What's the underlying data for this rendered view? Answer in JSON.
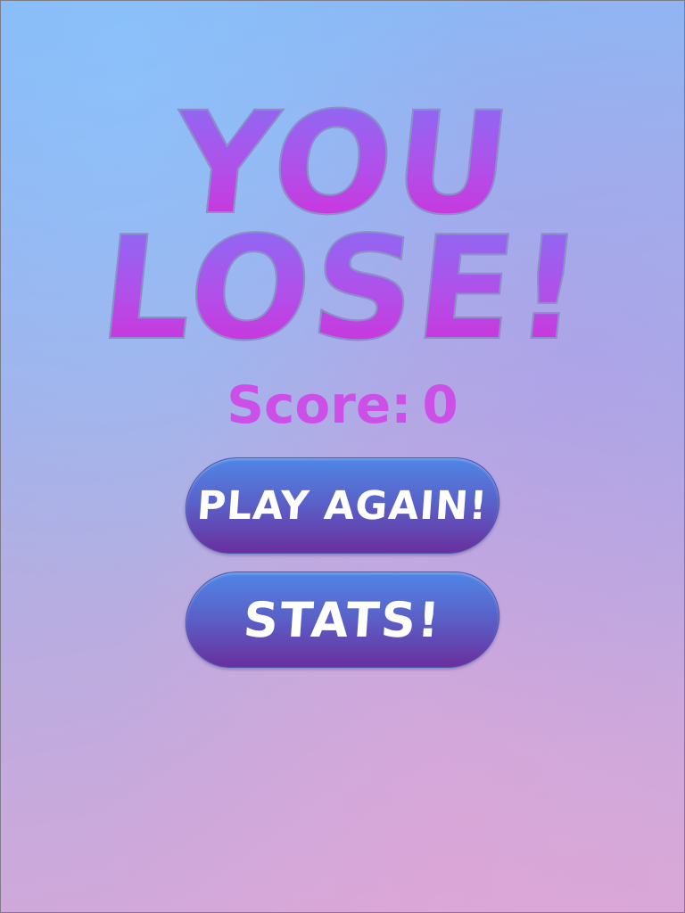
{
  "game_over": {
    "title_line1": "YOU",
    "title_line2": "LOSE!",
    "score_label": "Score:",
    "score_value": "0"
  },
  "buttons": {
    "play_again_label": "PLAY AGAIN!",
    "stats_label": "STATS!"
  },
  "colors": {
    "title_gradient_top": "#8a6cf4",
    "title_gradient_bottom": "#d22ed8",
    "score_text": "#cc4fe8",
    "button_top": "#4f86e6",
    "button_bottom": "#6a2f9e",
    "button_text": "#ffffff",
    "background_top": "#86b8f6",
    "background_bottom": "#d8a8d8"
  }
}
